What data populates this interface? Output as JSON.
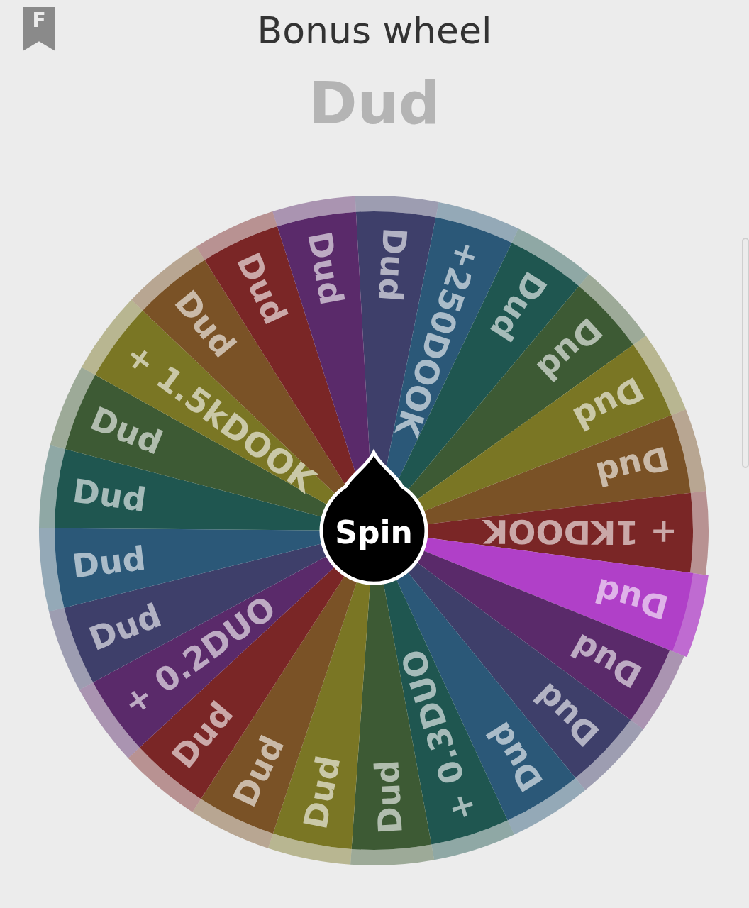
{
  "header": {
    "badge_letter": "F",
    "title": "Bonus wheel"
  },
  "result": "Dud",
  "wheel": {
    "spin_label": "Spin",
    "segments": [
      {
        "label": "Dud",
        "color": "#3e3f6a",
        "selected": false
      },
      {
        "label": "+250DOOK",
        "color": "#2b5878",
        "selected": false
      },
      {
        "label": "Dud",
        "color": "#1f5650",
        "selected": false
      },
      {
        "label": "Dud",
        "color": "#3d5a34",
        "selected": false
      },
      {
        "label": "Dud",
        "color": "#7a7624",
        "selected": false
      },
      {
        "label": "Dud",
        "color": "#7a5226",
        "selected": false
      },
      {
        "label": "+ 1KDOOK",
        "color": "#7a2626",
        "selected": false
      },
      {
        "label": "Dud",
        "color": "#b040c8",
        "selected": true
      },
      {
        "label": "Dud",
        "color": "#5a2a6a",
        "selected": false
      },
      {
        "label": "Dud",
        "color": "#3e3f6a",
        "selected": false
      },
      {
        "label": "Dud",
        "color": "#2b5878",
        "selected": false
      },
      {
        "label": "+ 0.3DUO",
        "color": "#1f5650",
        "selected": false
      },
      {
        "label": "Dud",
        "color": "#3d5a34",
        "selected": false
      },
      {
        "label": "Dud",
        "color": "#7a7624",
        "selected": false
      },
      {
        "label": "Dud",
        "color": "#7a5226",
        "selected": false
      },
      {
        "label": "Dud",
        "color": "#7a2626",
        "selected": false
      },
      {
        "label": "+ 0.2DUO",
        "color": "#5a2a6a",
        "selected": false
      },
      {
        "label": "Dud",
        "color": "#3e3f6a",
        "selected": false
      },
      {
        "label": "Dud",
        "color": "#2b5878",
        "selected": false
      },
      {
        "label": "Dud",
        "color": "#1f5650",
        "selected": false
      },
      {
        "label": "Dud",
        "color": "#3d5a34",
        "selected": false
      },
      {
        "label": "+ 1.5kDOOK",
        "color": "#7a7624",
        "selected": false
      },
      {
        "label": "Dud",
        "color": "#7a5226",
        "selected": false
      },
      {
        "label": "Dud",
        "color": "#7a2626",
        "selected": false
      },
      {
        "label": "Dud",
        "color": "#5a2a6a",
        "selected": false
      }
    ]
  }
}
